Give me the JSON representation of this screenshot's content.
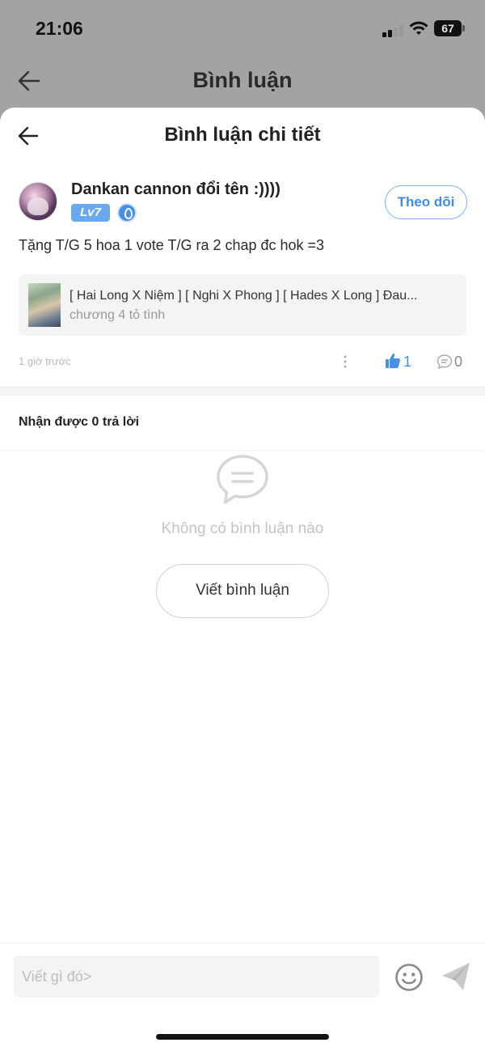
{
  "status_bar": {
    "time": "21:06",
    "battery": "67"
  },
  "background_page": {
    "title": "Bình luận"
  },
  "sheet": {
    "title": "Bình luận chi tiết"
  },
  "comment": {
    "username": "Dankan cannon đổi tên :))))",
    "level": "Lv7",
    "follow_label": "Theo dõi",
    "text": "Tặng T/G 5 hoa 1 vote T/G ra 2 chap đc hok =3",
    "story": {
      "title": "[ Hai Long X Niệm ] [ Nghi X Phong ] [ Hades X Long ] Đau...",
      "chapter": "chương 4 tỏ tình"
    },
    "time": "1 giờ trước",
    "likes": "1",
    "replies": "0"
  },
  "replies_section": {
    "label": "Nhận được 0 trả lời",
    "empty_text": "Không có bình luận nào",
    "write_button": "Viết bình luận"
  },
  "composer": {
    "placeholder": "Viết gì đó>"
  },
  "colors": {
    "accent": "#3f8ce8",
    "level_badge": "#6aa8f0"
  }
}
